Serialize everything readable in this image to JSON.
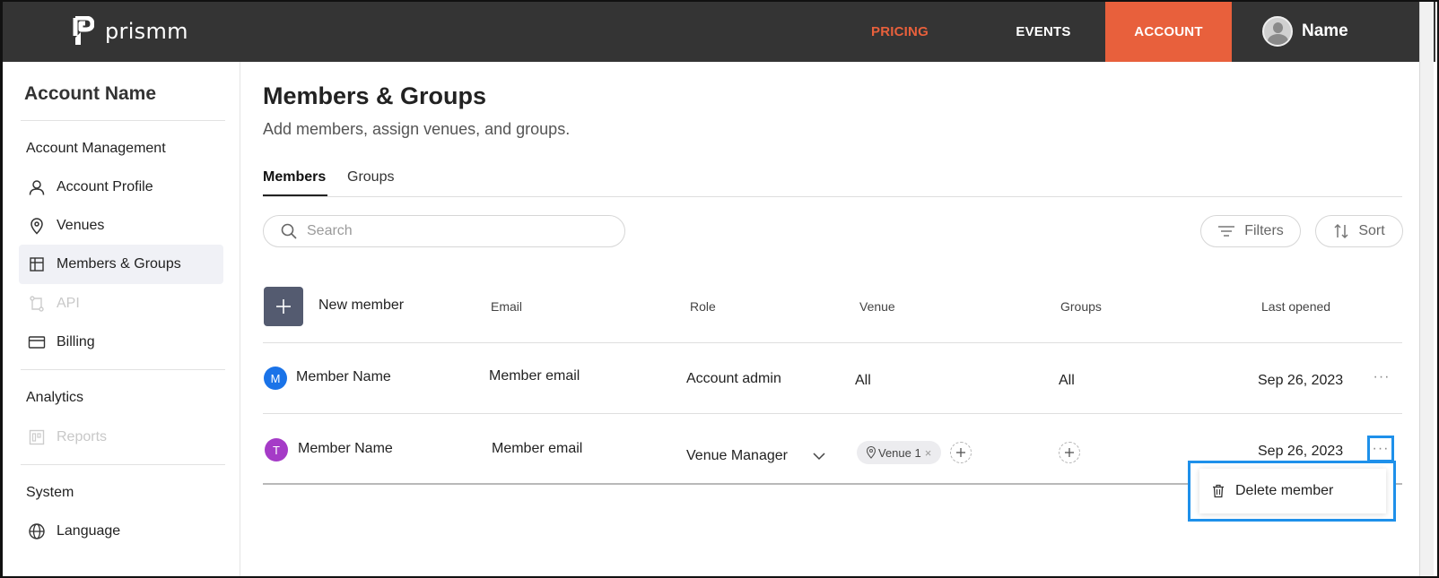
{
  "brand": {
    "name": "prismm",
    "accent": "#e8603c",
    "topbar_bg": "#343434"
  },
  "topnav": {
    "pricing": "PRICING",
    "events": "EVENTS",
    "account": "ACCOUNT",
    "user_name": "Name"
  },
  "sidebar": {
    "account_name": "Account Name",
    "sections": {
      "management": "Account Management",
      "analytics": "Analytics",
      "system": "System"
    },
    "items": {
      "account_profile": "Account Profile",
      "venues": "Venues",
      "members_groups": "Members & Groups",
      "api": "API",
      "billing": "Billing",
      "reports": "Reports",
      "language": "Language"
    }
  },
  "main": {
    "title": "Members & Groups",
    "subtitle": "Add members, assign venues, and groups.",
    "tabs": [
      "Members",
      "Groups"
    ],
    "search_placeholder": "Search",
    "filters_label": "Filters",
    "sort_label": "Sort",
    "new_member_label": "New member",
    "columns": {
      "email": "Email",
      "role": "Role",
      "venue": "Venue",
      "groups": "Groups",
      "last_opened": "Last opened"
    },
    "rows": [
      {
        "initial": "M",
        "avatar_color": "#1a73e8",
        "name": "Member Name",
        "email": "Member email",
        "role": "Account admin",
        "venue": "All",
        "groups": "All",
        "last_opened": "Sep 26, 2023"
      },
      {
        "initial": "T",
        "avatar_color": "#a53bc7",
        "name": "Member Name",
        "email": "Member email",
        "role": "Venue Manager",
        "venue_chip": "Venue 1",
        "last_opened": "Sep 26, 2023"
      }
    ],
    "more_label": "···",
    "menu": {
      "delete_member": "Delete member"
    }
  },
  "highlight_color": "#1e90ea"
}
